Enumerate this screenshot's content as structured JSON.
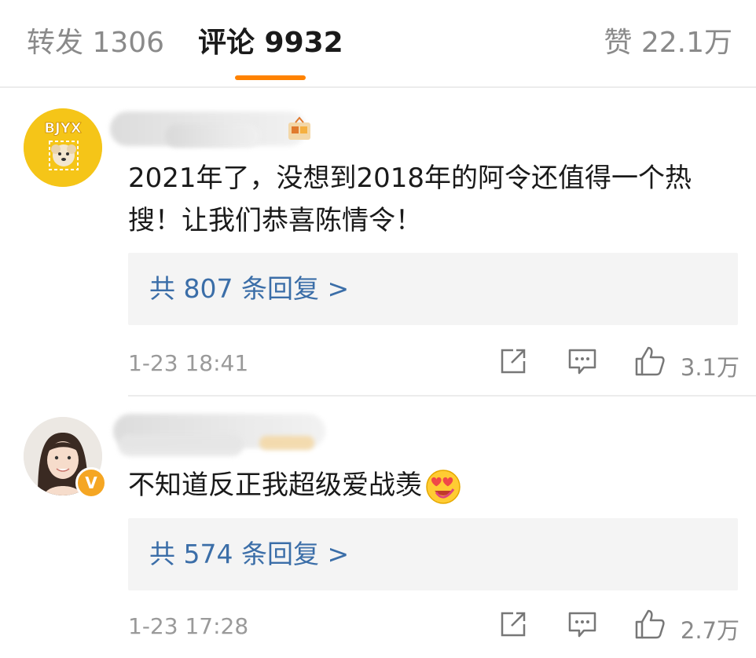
{
  "tabs": {
    "repost": "转发 1306",
    "comments": "评论 9932",
    "likes": "赞 22.1万",
    "active": "comments",
    "accent_color": "#ff8200"
  },
  "comments": [
    {
      "avatar_icon": "dog-avatar-icon",
      "avatar_text": "BJYX",
      "text": "2021年了，没想到2018年的阿令还值得一个热搜！让我们恭喜陈情令！",
      "reply_link": "共 807 条回复 >",
      "timestamp": "1-23 18:41",
      "like_count": "3.1万"
    },
    {
      "avatar_icon": "user-photo-avatar-icon",
      "verified": true,
      "text": "不知道反正我超级爱战羡",
      "emoji": "heart-eyes-emoji-icon",
      "reply_link": "共 574 条回复 >",
      "timestamp": "1-23 17:28",
      "like_count": "2.7万"
    }
  ],
  "colors": {
    "link": "#3b6ea8",
    "reply_bg": "#f4f4f4",
    "muted": "#8a8a8a"
  }
}
